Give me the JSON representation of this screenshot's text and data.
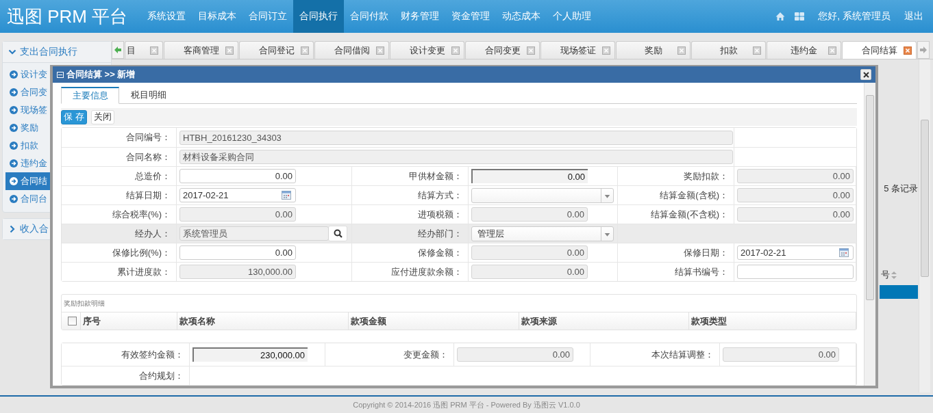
{
  "header": {
    "logo": "迅图 PRM 平台",
    "nav": [
      {
        "label": "系统设置",
        "selected": false
      },
      {
        "label": "目标成本",
        "selected": false
      },
      {
        "label": "合同订立",
        "selected": false
      },
      {
        "label": "合同执行",
        "selected": true
      },
      {
        "label": "合同付款",
        "selected": false
      },
      {
        "label": "财务管理",
        "selected": false
      },
      {
        "label": "资金管理",
        "selected": false
      },
      {
        "label": "动态成本",
        "selected": false
      },
      {
        "label": "个人助理",
        "selected": false
      }
    ],
    "greeting": "您好, 系统管理员",
    "logout": "退出"
  },
  "sidebar": {
    "groups": [
      {
        "title": "支出合同执行",
        "expanded": true,
        "items": [
          {
            "label": "设计变",
            "selected": false
          },
          {
            "label": "合同变",
            "selected": false
          },
          {
            "label": "现场签",
            "selected": false
          },
          {
            "label": "奖励",
            "selected": false
          },
          {
            "label": "扣款",
            "selected": false
          },
          {
            "label": "违约金",
            "selected": false
          },
          {
            "label": "合同结",
            "selected": true
          },
          {
            "label": "合同台",
            "selected": false
          }
        ]
      },
      {
        "title": "收入合",
        "expanded": false
      }
    ]
  },
  "tabs": [
    {
      "label": "目",
      "selected": false
    },
    {
      "label": "客商管理",
      "selected": false
    },
    {
      "label": "合同登记",
      "selected": false
    },
    {
      "label": "合同借阅",
      "selected": false
    },
    {
      "label": "设计变更",
      "selected": false
    },
    {
      "label": "合同变更",
      "selected": false
    },
    {
      "label": "现场签证",
      "selected": false
    },
    {
      "label": "奖励",
      "selected": false
    },
    {
      "label": "扣款",
      "selected": false
    },
    {
      "label": "违约金",
      "selected": false
    },
    {
      "label": "合同结算",
      "selected": true
    }
  ],
  "background": {
    "record_count": "5 条记录",
    "column_header": "号"
  },
  "dialog": {
    "title": "合同结算 >> 新增",
    "tabs": [
      {
        "label": "主要信息",
        "selected": true
      },
      {
        "label": "税目明细",
        "selected": false
      }
    ],
    "buttons": [
      {
        "label": "保 存",
        "kind": "primary"
      },
      {
        "label": "关闭",
        "kind": "plain"
      }
    ],
    "form_rows": [
      {
        "highlighted": false,
        "fields": [
          {
            "label": "合同编号：",
            "value": "HTBH_20161230_34303",
            "kind": "wide"
          }
        ]
      },
      {
        "highlighted": false,
        "fields": [
          {
            "label": "合同名称：",
            "value": "材料设备采购合同",
            "kind": "wide"
          }
        ]
      },
      {
        "highlighted": false,
        "fields": [
          {
            "label": "总造价：",
            "value": "0.00",
            "kind": "input"
          },
          {
            "label": "甲供材金额：",
            "value": "0.00",
            "kind": "sunken"
          },
          {
            "label": "奖励扣款：",
            "value": "0.00",
            "kind": "readonly"
          }
        ]
      },
      {
        "highlighted": false,
        "fields": [
          {
            "label": "结算日期：",
            "value": "2017-02-21",
            "kind": "date"
          },
          {
            "label": "结算方式：",
            "kind": "select"
          },
          {
            "label": "结算金额(含税)：",
            "value": "0.00",
            "kind": "readonly"
          }
        ]
      },
      {
        "highlighted": false,
        "fields": [
          {
            "label": "综合税率(%)：",
            "value": "0.00",
            "kind": "readonly"
          },
          {
            "label": "进项税额：",
            "value": "0.00",
            "kind": "readonly"
          },
          {
            "label": "结算金额(不含税)：",
            "value": "0.00",
            "kind": "readonly"
          }
        ]
      },
      {
        "highlighted": true,
        "fields": [
          {
            "label": "经办人：",
            "value": "系统管理员",
            "kind": "lookup"
          },
          {
            "label": "经办部门：",
            "value": "管理层",
            "kind": "select"
          }
        ]
      },
      {
        "highlighted": false,
        "fields": [
          {
            "label": "保修比例(%)：",
            "value": "0.00",
            "kind": "input"
          },
          {
            "label": "保修金额：",
            "value": "0.00",
            "kind": "readonly"
          },
          {
            "label": "保修日期：",
            "value": "2017-02-21",
            "kind": "date"
          }
        ]
      },
      {
        "highlighted": false,
        "fields": [
          {
            "label": "累计进度款：",
            "value": "130,000.00",
            "kind": "readonly"
          },
          {
            "label": "应付进度款余额：",
            "value": "0.00",
            "kind": "readonly"
          },
          {
            "label": "结算书编号：",
            "kind": "input"
          }
        ]
      }
    ],
    "detail": {
      "title": "奖励扣款明细",
      "select_all": {
        "checked": false
      },
      "columns": [
        "序号",
        "款项名称",
        "款项金额",
        "款项来源",
        "款项类型"
      ]
    },
    "summary_rows": [
      {
        "fields": [
          {
            "label": "有效签约金额：",
            "value": "230,000.00",
            "kind": "sunken"
          },
          {
            "label": "变更金额：",
            "value": "0.00",
            "kind": "readonly"
          },
          {
            "label": "本次结算调整：",
            "value": "0.00",
            "kind": "readonly"
          }
        ]
      },
      {
        "fields": [
          {
            "label": "合约规划：",
            "kind": "empty"
          }
        ]
      }
    ]
  },
  "footer": "Copyright © 2014-2016 迅图 PRM 平台 - Powered By 迅图云 V1.0.0"
}
